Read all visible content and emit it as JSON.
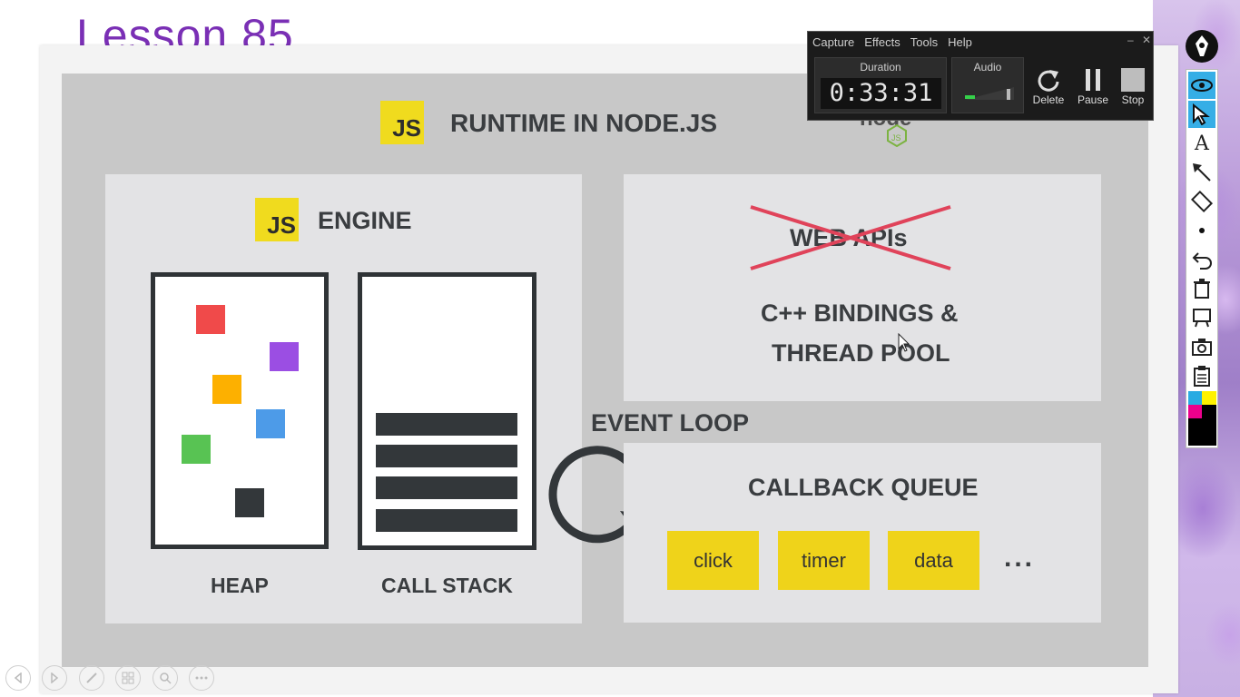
{
  "window": {
    "lesson_title": "Lesson 85"
  },
  "slide": {
    "title": "RUNTIME IN NODE.JS",
    "js_badge": "JS",
    "engine_title": "ENGINE",
    "heap_label": "HEAP",
    "call_stack_label": "CALL STACK",
    "web_apis_label": "WEB APIs",
    "bindings_line1": "C++ BINDINGS &",
    "bindings_line2": "THREAD POOL",
    "event_loop_label": "EVENT LOOP",
    "callback_queue_label": "CALLBACK QUEUE",
    "queue_items": [
      "click",
      "timer",
      "data"
    ],
    "queue_more": "...",
    "colors": {
      "badge": "#f0db1e",
      "cross": "#e0435a",
      "queue_item": "#efd31a",
      "panel": "#e3e3e5"
    }
  },
  "recorder": {
    "menu": [
      "Capture",
      "Effects",
      "Tools",
      "Help"
    ],
    "duration_label": "Duration",
    "duration_value": "0:33:31",
    "audio_label": "Audio",
    "buttons": {
      "delete": "Delete",
      "pause": "Pause",
      "stop": "Stop"
    }
  },
  "annotation_toolbar": {
    "tools": [
      "eye-icon",
      "pointer-icon",
      "text-icon",
      "arrow-icon",
      "eraser-icon",
      "dot-icon",
      "undo-icon",
      "trash-icon",
      "whiteboard-icon",
      "camera-icon",
      "clipboard-icon"
    ],
    "palette": [
      "#29abe2",
      "#fff200",
      "#ec008c",
      "#000000"
    ]
  },
  "slide_nav": [
    "previous-icon",
    "next-icon",
    "pen-icon",
    "slides-icon",
    "zoom-icon",
    "more-icon"
  ]
}
